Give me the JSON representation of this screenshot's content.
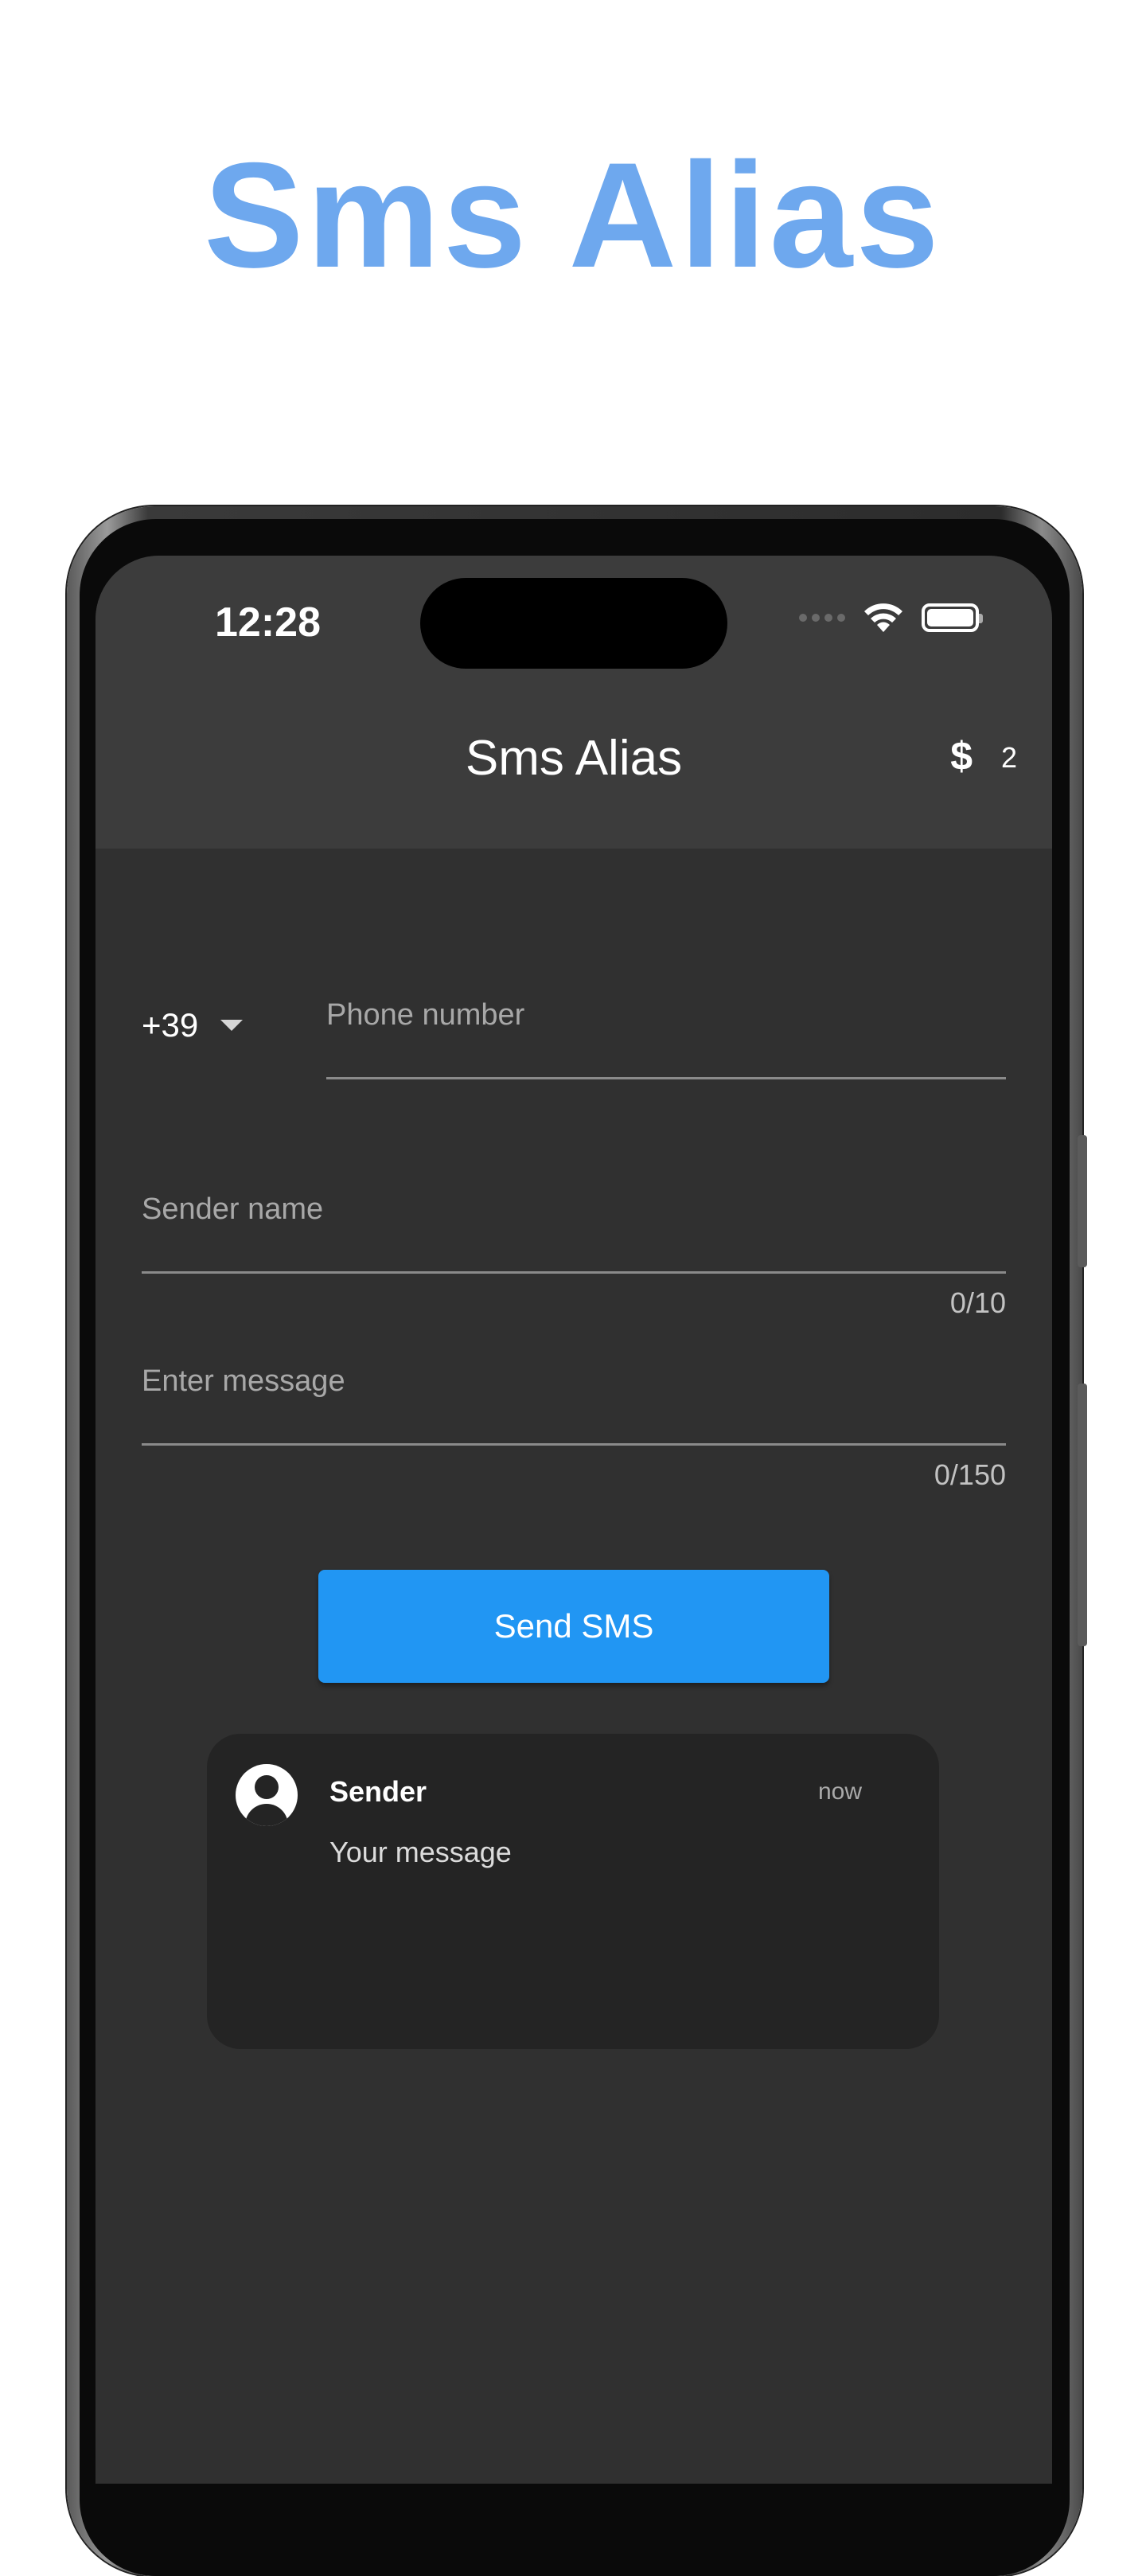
{
  "hero": {
    "title": "Sms Alias"
  },
  "status_bar": {
    "time": "12:28"
  },
  "app_bar": {
    "title": "Sms Alias",
    "credits_icon": "$",
    "credits_count": "2"
  },
  "form": {
    "country_code": "+39",
    "phone_placeholder": "Phone number",
    "sender_placeholder": "Sender name",
    "sender_counter": "0/10",
    "message_placeholder": "Enter message",
    "message_counter": "0/150",
    "send_label": "Send SMS"
  },
  "preview": {
    "sender": "Sender",
    "time": "now",
    "message": "Your message"
  },
  "colors": {
    "accent": "#2196f3",
    "hero": "#6ea8ee",
    "screen_bg": "#303030",
    "app_bar_bg": "#3c3c3c"
  }
}
